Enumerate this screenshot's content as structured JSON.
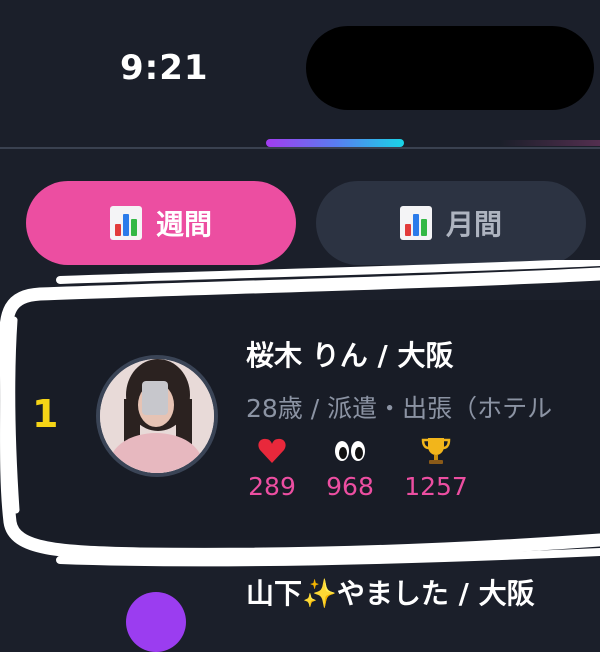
{
  "status_bar": {
    "time": "9:21"
  },
  "tabs": [
    {
      "label": "週間",
      "active": true
    },
    {
      "label": "月間",
      "active": false
    }
  ],
  "ranking": [
    {
      "rank": "1",
      "name": "桜木 りん / 大阪",
      "details": "28歳 / 派遣・出張（ホテル",
      "stats": {
        "likes": "289",
        "views": "968",
        "trophies": "1257"
      }
    },
    {
      "name": "山下✨やました / 大阪"
    }
  ],
  "colors": {
    "accent": "#ec4ea1",
    "rank_gold": "#f5d416",
    "background": "#1b1f2a"
  },
  "icons": {
    "tab_icon": "bar-chart-icon",
    "likes": "heart-icon",
    "views": "eyes-icon",
    "trophies": "trophy-icon"
  }
}
